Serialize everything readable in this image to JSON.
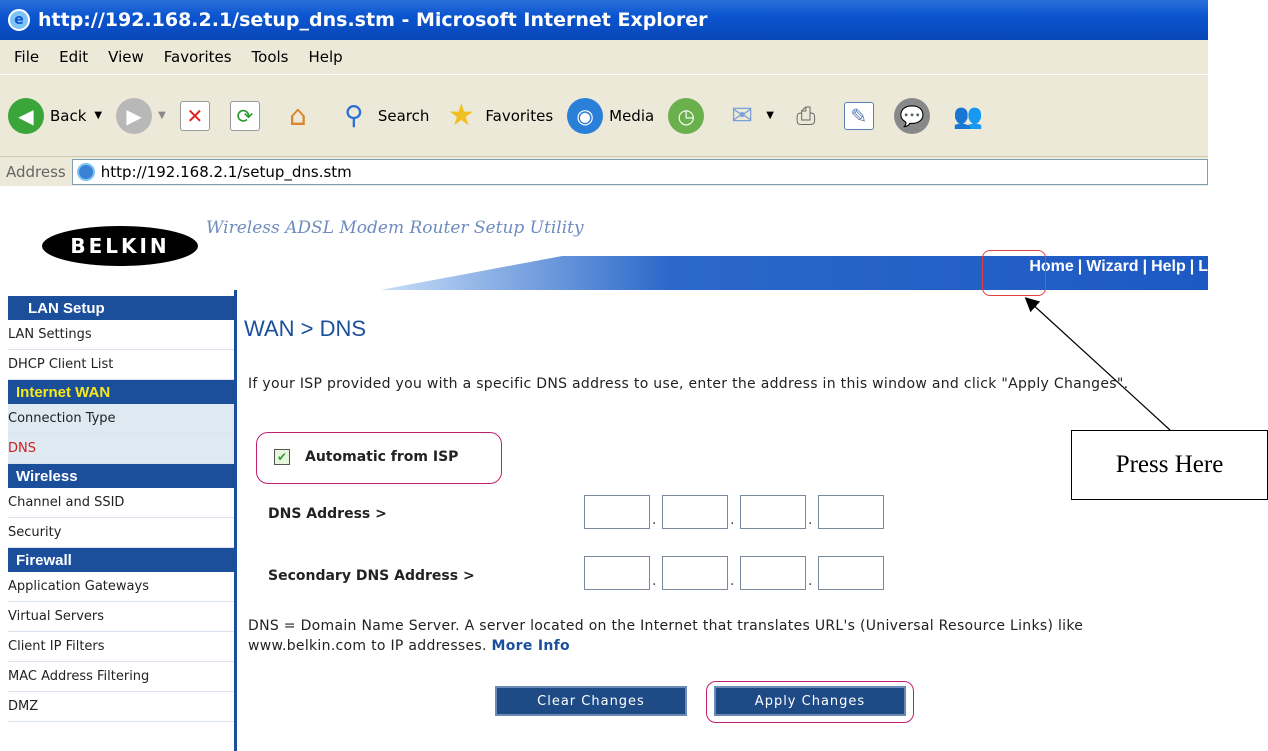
{
  "window": {
    "title": "http://192.168.2.1/setup_dns.stm - Microsoft Internet Explorer"
  },
  "menu": [
    "File",
    "Edit",
    "View",
    "Favorites",
    "Tools",
    "Help"
  ],
  "toolbar": {
    "back": "Back",
    "search": "Search",
    "favorites": "Favorites",
    "media": "Media"
  },
  "address": {
    "label": "Address",
    "url": "http://192.168.2.1/setup_dns.stm"
  },
  "header": {
    "logo": "BELKIN",
    "tagline": "Wireless ADSL Modem Router Setup Utility",
    "nav": {
      "home": "Home",
      "wizard": "Wizard",
      "help": "Help",
      "logout": "L"
    }
  },
  "sidebar": {
    "sections": [
      {
        "title": "LAN Setup",
        "items": [
          "LAN Settings",
          "DHCP Client List"
        ]
      },
      {
        "title": "Internet WAN",
        "items": [
          "Connection Type",
          "DNS"
        ]
      },
      {
        "title": "Wireless",
        "items": [
          "Channel and SSID",
          "Security"
        ]
      },
      {
        "title": "Firewall",
        "items": [
          "Application Gateways",
          "Virtual Servers",
          "Client IP Filters",
          "MAC Address Filtering",
          "DMZ"
        ]
      }
    ]
  },
  "main": {
    "title": "WAN > DNS",
    "intro": "If your ISP provided you with a specific DNS address to use, enter the address in this window and click \"Apply Changes\".",
    "auto_label": "Automatic from ISP",
    "dns_label": "DNS Address >",
    "secondary_label": "Secondary DNS Address >",
    "note": "DNS = Domain Name Server. A server located on the Internet that translates URL's (Universal Resource Links) like www.belkin.com to IP addresses.",
    "more_info": "More Info",
    "clear_button": "Clear Changes",
    "apply_button": "Apply Changes"
  },
  "callout": {
    "text": "Press Here"
  }
}
